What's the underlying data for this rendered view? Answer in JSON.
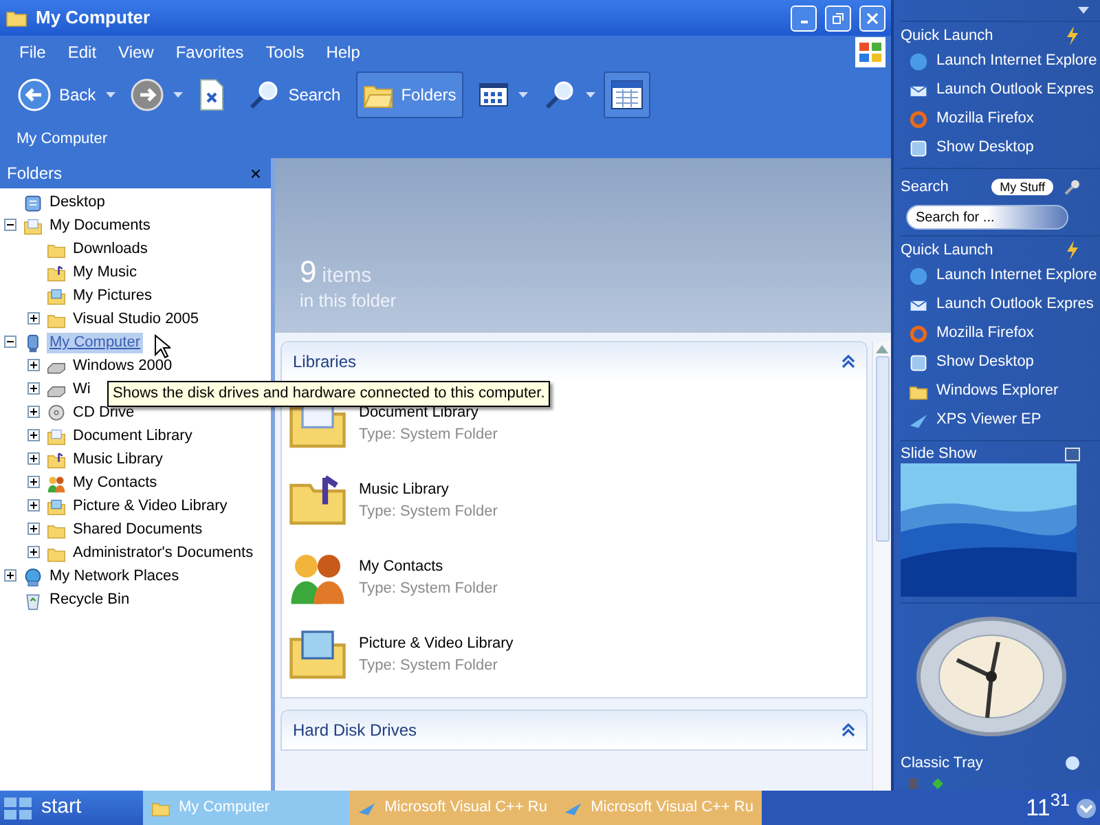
{
  "window": {
    "title": "My Computer"
  },
  "menu": [
    "File",
    "Edit",
    "View",
    "Favorites",
    "Tools",
    "Help"
  ],
  "toolbar": [
    {
      "kind": "back",
      "label": "Back",
      "on": false
    },
    {
      "kind": "forward",
      "on": false
    },
    {
      "kind": "up",
      "on": false
    },
    {
      "kind": "search",
      "label": "Search",
      "on": false
    },
    {
      "kind": "folders",
      "label": "Folders",
      "on": true
    },
    {
      "kind": "views",
      "on": false
    },
    {
      "kind": "find",
      "on": false
    },
    {
      "kind": "calendar",
      "on": true
    }
  ],
  "address": "My Computer",
  "folders_pane": {
    "title": "Folders",
    "close": "×",
    "tree": [
      {
        "label": "Desktop",
        "kind": "desktop",
        "selected": false
      },
      {
        "label": "My Documents",
        "kind": "documents",
        "selected": false,
        "expanded": true,
        "children": [
          {
            "label": "Downloads",
            "kind": "folder",
            "selected": false
          },
          {
            "label": "My Music",
            "kind": "music",
            "selected": false
          },
          {
            "label": "My Pictures",
            "kind": "pictures",
            "selected": false
          },
          {
            "label": "Visual Studio 2005",
            "kind": "folder",
            "selected": false,
            "expanded": false
          }
        ]
      },
      {
        "label": "My Computer",
        "kind": "computer",
        "selected": true,
        "expanded": true,
        "children": [
          {
            "label": "Windows 2000",
            "kind": "drive",
            "selected": false,
            "expanded": false
          },
          {
            "label": "Wi",
            "kind": "drive",
            "selected": false,
            "expanded": false
          },
          {
            "label": "CD Drive",
            "kind": "cd",
            "selected": false,
            "expanded": false
          },
          {
            "label": "Document Library",
            "kind": "documents",
            "selected": false,
            "expanded": false
          },
          {
            "label": "Music Library",
            "kind": "music",
            "selected": false,
            "expanded": false
          },
          {
            "label": "My Contacts",
            "kind": "contacts",
            "selected": false,
            "expanded": false
          },
          {
            "label": "Picture & Video Library",
            "kind": "pictures",
            "selected": false,
            "expanded": false
          },
          {
            "label": "Shared Documents",
            "kind": "folder",
            "selected": false,
            "expanded": false
          },
          {
            "label": "Administrator's Documents",
            "kind": "folder",
            "selected": false,
            "expanded": false
          }
        ]
      },
      {
        "label": "My Network Places",
        "kind": "network",
        "selected": false,
        "expanded": false
      },
      {
        "label": "Recycle Bin",
        "kind": "recycle",
        "selected": false
      }
    ]
  },
  "tooltip": "Shows the disk drives and hardware connected to this computer.",
  "banner": {
    "count": "9",
    "unit": "items",
    "caption": "in this folder"
  },
  "sections": [
    {
      "title": "Libraries",
      "expanded": true,
      "items": [
        {
          "name": "Document Library",
          "type": "Type: System Folder",
          "kind": "documents"
        },
        {
          "name": "Music Library",
          "type": "Type: System Folder",
          "kind": "music"
        },
        {
          "name": "My Contacts",
          "type": "Type: System Folder",
          "kind": "contacts"
        },
        {
          "name": "Picture & Video Library",
          "type": "Type: System Folder",
          "kind": "pictures"
        }
      ]
    },
    {
      "title": "Hard Disk Drives",
      "expanded": true
    }
  ],
  "taskbar": {
    "start": "start",
    "tasks": [
      {
        "label": "My Computer",
        "selected": true,
        "kind": "explorer"
      },
      {
        "label": "Microsoft Visual C++ Ru",
        "selected": false,
        "kind": "installer"
      },
      {
        "label": "Microsoft Visual C++ Ru",
        "selected": false,
        "kind": "installer"
      }
    ],
    "clock": "11$^{31}$"
  },
  "sidebar": [
    {
      "kind": "links",
      "title": "Quick Launch",
      "items": [
        {
          "label": "Launch Internet Explore",
          "kind": "ie"
        },
        {
          "label": "Launch Outlook Expres",
          "kind": "outlook"
        },
        {
          "label": "Mozilla Firefox",
          "kind": "firefox"
        },
        {
          "label": "Show Desktop",
          "kind": "desktop"
        }
      ]
    },
    {
      "kind": "search",
      "title": "Search",
      "button": "My Stuff",
      "placeholder": "Search for ..."
    },
    {
      "kind": "links",
      "title": "Quick Launch",
      "items": [
        {
          "label": "Launch Internet Explore",
          "kind": "ie"
        },
        {
          "label": "Launch Outlook Expres",
          "kind": "outlook"
        },
        {
          "label": "Mozilla Firefox",
          "kind": "firefox"
        },
        {
          "label": "Show Desktop",
          "kind": "desktop"
        },
        {
          "label": "Windows Explorer",
          "kind": "explorer"
        },
        {
          "label": "XPS Viewer EP",
          "kind": "xps"
        }
      ]
    },
    {
      "kind": "slideshow",
      "title": "Slide Show"
    },
    {
      "kind": "clock"
    },
    {
      "kind": "tray",
      "title": "Classic Tray"
    }
  ]
}
